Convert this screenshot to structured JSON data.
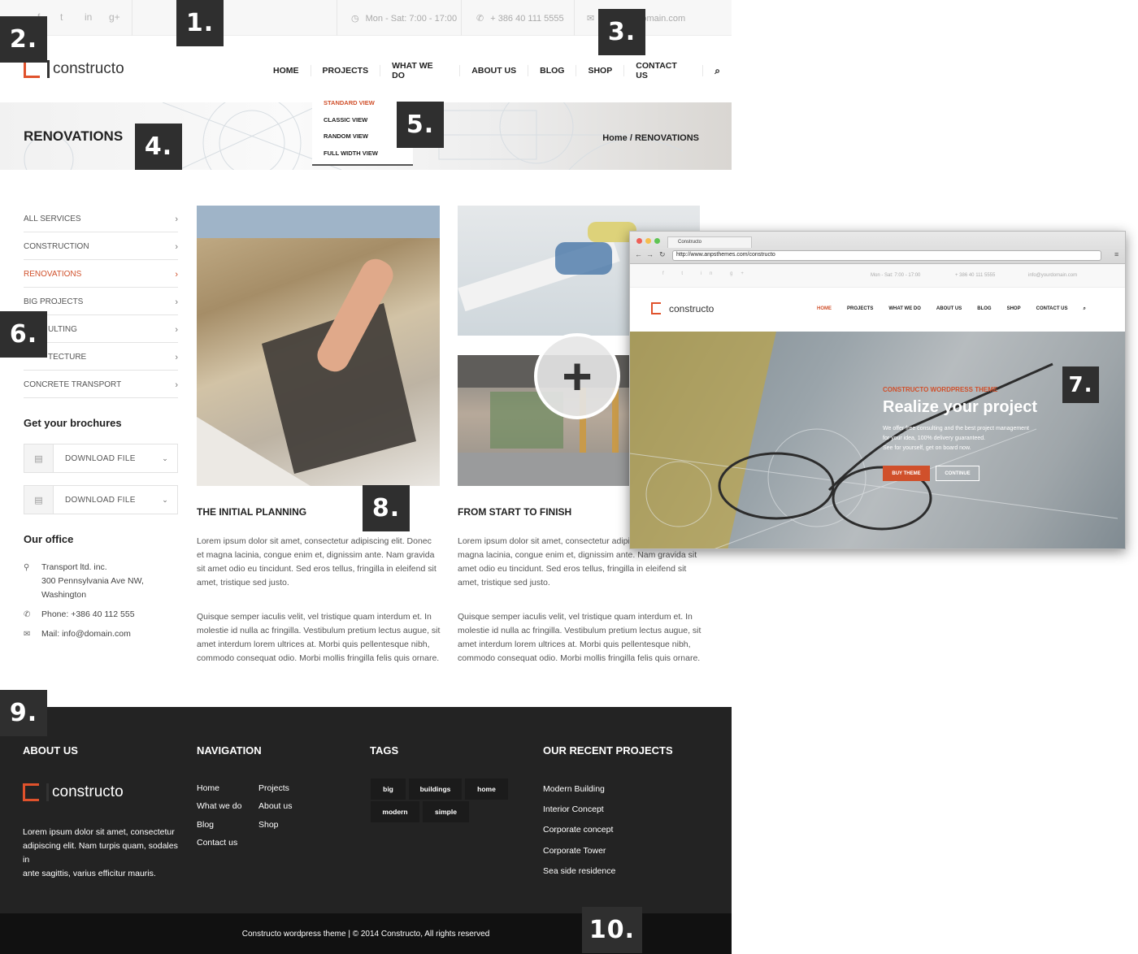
{
  "topbar": {
    "hours": "Mon - Sat: 7:00 - 17:00",
    "phone": "+ 386 40 111 5555",
    "email_visible": "domain.com"
  },
  "header": {
    "logo": "constructo",
    "nav": [
      "HOME",
      "PROJECTS",
      "WHAT WE DO",
      "ABOUT US",
      "BLOG",
      "SHOP",
      "CONTACT US"
    ]
  },
  "dropdown": [
    "STANDARD VIEW",
    "CLASSIC VIEW",
    "RANDOM VIEW",
    "FULL WIDTH VIEW"
  ],
  "banner": {
    "title": "RENOVATIONS",
    "breadcrumb": "Home / RENOVATIONS"
  },
  "badges": [
    "1.",
    "2.",
    "3.",
    "4.",
    "5.",
    "6.",
    "7.",
    "8.",
    "9.",
    "10."
  ],
  "sidebar": {
    "items": [
      {
        "label": "ALL SERVICES"
      },
      {
        "label": "CONSTRUCTION"
      },
      {
        "label": "RENOVATIONS"
      },
      {
        "label": "BIG PROJECTS"
      },
      {
        "label": "ULTING"
      },
      {
        "label": "TECTURE"
      },
      {
        "label": "CONCRETE TRANSPORT"
      }
    ],
    "brochures_title": "Get your brochures",
    "download_label": "DOWNLOAD FILE",
    "office_title": "Our office",
    "office_address": [
      "Transport ltd. inc.",
      "300 Pennsylvania Ave NW,",
      "Washington"
    ],
    "office_phone": "Phone: +386 40 112 555",
    "office_mail": "Mail: info@domain.com"
  },
  "content": {
    "col1_title": "THE INITIAL PLANNING",
    "col2_title": "FROM START TO FINISH",
    "para1": "Lorem ipsum dolor sit amet, consectetur adipiscing elit. Donec et magna lacinia, congue enim et, dignissim ante. Nam gravida sit amet odio eu tincidunt. Sed eros tellus, fringilla in eleifend sit amet, tristique sed justo.",
    "para2": "Quisque semper iaculis velit, vel tristique quam interdum et. In molestie id nulla ac fringilla. Vestibulum pretium lectus augue, sit amet interdum lorem ultrices at. Morbi quis pellentesque nibh, commodo consequat odio. Morbi mollis fringilla felis quis ornare.",
    "col2_para1": "Lorem ipsum dolor sit amet, consectetur adipisci",
    "col2_para1b": "magna lacinia, congue enim et, dignissim ante. Nam gravida sit amet odio eu tincidunt. Sed eros tellus, fringilla in eleifend sit amet, tristique sed justo.",
    "plus": "+"
  },
  "browser": {
    "tab": "Constructo",
    "url": "http://www.anpsthemes.com/constructo",
    "hours": "Mon - Sat: 7:00 - 17:00",
    "phone": "+ 386 40 111 5555",
    "email": "info@yourdomain.com",
    "logo": "constructo",
    "nav": [
      "HOME",
      "PROJECTS",
      "WHAT WE DO",
      "ABOUT US",
      "BLOG",
      "SHOP",
      "CONTACT US"
    ],
    "kicker": "CONSTRUCTO WORDPRESS THEME",
    "headline": "Realize your project",
    "sub1": "We offer free consulting and the best project management",
    "sub2": "for your idea, 100% delivery guaranteed.",
    "sub3": "See for yourself, get on board now.",
    "btn_buy": "BUY THEME",
    "btn_continue": "CONTINUE"
  },
  "footer": {
    "about_title": "ABOUT US",
    "logo": "constructo",
    "about_text": [
      "Lorem ipsum dolor sit amet, consectetur",
      "adipiscing elit. Nam turpis quam, sodales in",
      "ante sagittis, varius efficitur mauris."
    ],
    "nav_title": "NAVIGATION",
    "nav_left": [
      "Home",
      "What we do",
      "Blog",
      "Contact us"
    ],
    "nav_right": [
      "Projects",
      "About us",
      "Shop"
    ],
    "tags_title": "TAGS",
    "tags": [
      "big",
      "buildings",
      "home",
      "modern",
      "simple"
    ],
    "projects_title": "OUR RECENT PROJECTS",
    "projects": [
      "Modern Building",
      "Interior Concept",
      "Corporate concept",
      "Corporate Tower",
      "Sea side residence"
    ],
    "copyright": "Constructo wordpress theme | © 2014 Constructo, All rights reserved"
  },
  "colors": {
    "accent": "#d0502b",
    "footer": "#232323",
    "badge": "#2f2f2f"
  }
}
